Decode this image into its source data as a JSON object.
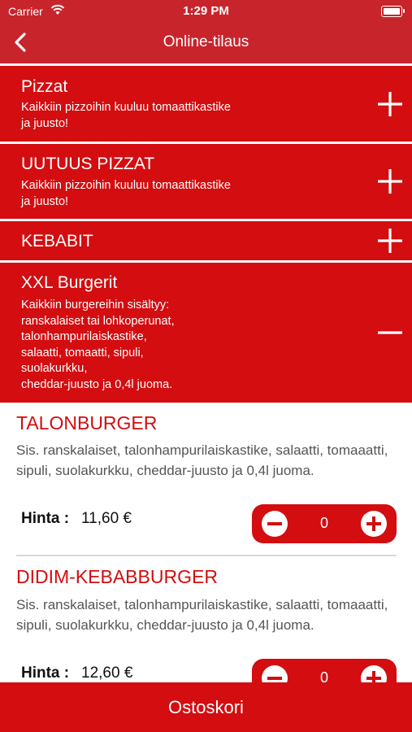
{
  "status": {
    "carrier": "Carrier",
    "time": "1:29 PM"
  },
  "nav": {
    "title": "Online-tilaus"
  },
  "categories": [
    {
      "title": "Pizzat",
      "desc": "Kaikkiin pizzoihin kuuluu tomaattikastike\nja juusto!",
      "expanded": false
    },
    {
      "title": "UUTUUS PIZZAT",
      "desc": "Kaikkiin pizzoihin kuuluu tomaattikastike\nja juusto!",
      "expanded": false
    },
    {
      "title": "KEBABIT",
      "desc": "",
      "expanded": false
    },
    {
      "title": "XXL Burgerit",
      "desc": "Kaikkiin burgereihin sisältyy:\nranskalaiset tai lohkoperunat,\ntalonhampurilaiskastike,\nsalaatti, tomaatti, sipuli,\nsuolakurkku,\ncheddar-juusto ja 0,4l juoma.",
      "expanded": true
    }
  ],
  "products": [
    {
      "name": "TALONBURGER",
      "desc": "Sis. ranskalaiset, talonhampurilaiskastike, salaatti, tomaaatti, sipuli, suolakurkku, cheddar-juusto ja 0,4l juoma.",
      "price_label": "Hinta :",
      "price": "11,60 €",
      "qty": "0"
    },
    {
      "name": "DIDIM-KEBABBURGER",
      "desc": "Sis. ranskalaiset, talonhampurilaiskastike, salaatti, tomaaatti, sipuli, suolakurkku, cheddar-juusto ja 0,4l juoma.",
      "price_label": "Hinta :",
      "price": "12,60 €",
      "qty": "0"
    }
  ],
  "cart": {
    "label": "Ostoskori"
  },
  "colors": {
    "header": "#c8242c",
    "accent": "#d30d10",
    "text_muted": "#555555"
  },
  "icons": {
    "back": "chevron-left-icon",
    "expand": "plus-icon",
    "collapse": "minus-icon",
    "decrease": "minus-circle-icon",
    "increase": "plus-circle-icon"
  }
}
